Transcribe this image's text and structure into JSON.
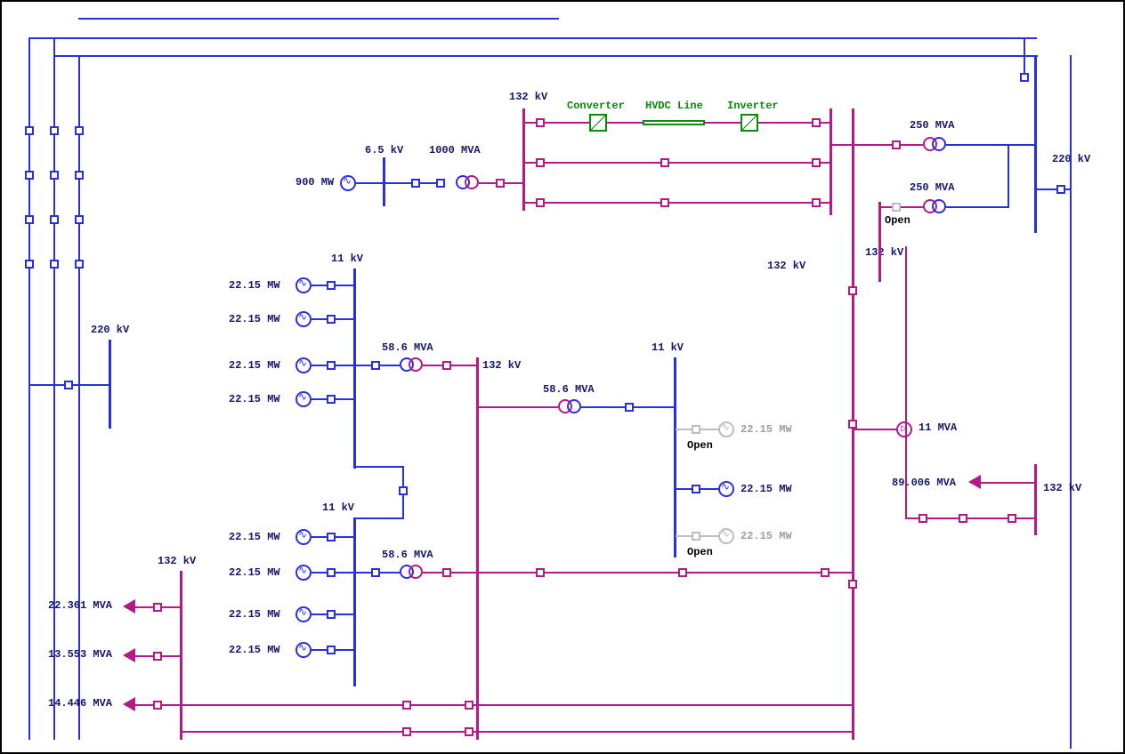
{
  "voltages": {
    "kv220_left": "220 kV",
    "kv220_right": "220 kV",
    "kv132_top": "132 kV",
    "kv132_load": "132 kV",
    "kv132_mid": "132 kV",
    "kv132_right1": "132 kV",
    "kv132_right2": "132 kV",
    "kv132_far": "132 kV",
    "kv11_a": "11 kV",
    "kv11_b": "11 kV",
    "kv11_c": "11 kV",
    "kv6_5": "6.5 kV"
  },
  "hvdc": {
    "converter": "Converter",
    "line": "HVDC Line",
    "inverter": "Inverter"
  },
  "ratings": {
    "mva250_a": "250 MVA",
    "mva250_b": "250 MVA",
    "mva1000": "1000 MVA",
    "mva58_a": "58.6 MVA",
    "mva58_b": "58.6 MVA",
    "mva58_c": "58.6 MVA",
    "mva11": "11 MVA",
    "mva89": "89.006 MVA",
    "mw900": "900 MW"
  },
  "gens": {
    "g1": "22.15 MW",
    "g2": "22.15 MW",
    "g3": "22.15 MW",
    "g4": "22.15 MW",
    "g5": "22.15 MW",
    "g6": "22.15 MW",
    "g7": "22.15 MW",
    "g8": "22.15 MW",
    "gr1": "22.15 MW",
    "gr1_open": "Open",
    "gr2": "22.15 MW",
    "gr3": "22.15 MW",
    "gr3_open": "Open"
  },
  "loads": {
    "l1": "22.361 MVA",
    "l2": "13.553 MVA",
    "l3": "14.446 MVA"
  },
  "open_label": "Open"
}
